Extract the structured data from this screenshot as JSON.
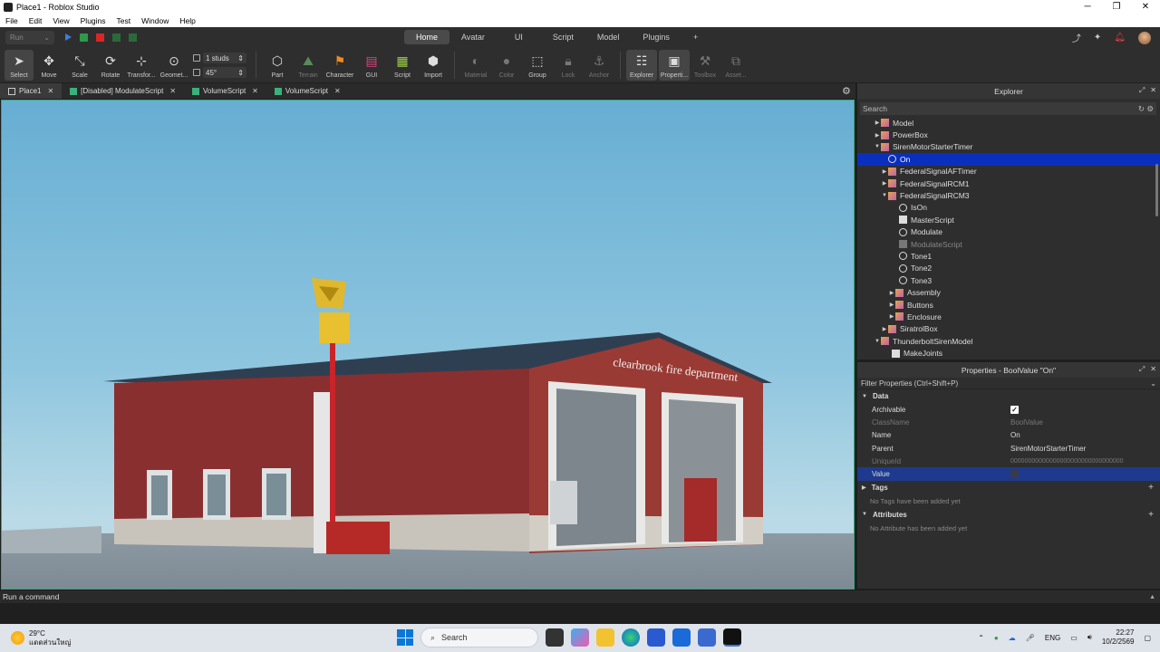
{
  "window": {
    "title": "Place1 - Roblox Studio"
  },
  "menu": [
    "File",
    "Edit",
    "View",
    "Plugins",
    "Test",
    "Window",
    "Help"
  ],
  "run": {
    "label": "Run"
  },
  "ribbon_tabs": [
    {
      "label": "Home",
      "active": true
    },
    {
      "label": "Avatar"
    },
    {
      "label": "UI"
    },
    {
      "label": "Script"
    },
    {
      "label": "Model"
    },
    {
      "label": "Plugins"
    },
    {
      "label": "+"
    }
  ],
  "tools": {
    "select": "Select",
    "move": "Move",
    "scale": "Scale",
    "rotate": "Rotate",
    "transform": "Transfor...",
    "geometry": "Geomet...",
    "part": "Part",
    "terrain": "Terrain",
    "character": "Character",
    "gui": "GUI",
    "script": "Script",
    "import": "Import",
    "material": "Material",
    "color": "Color",
    "group": "Group",
    "lock": "Lock",
    "anchor": "Anchor",
    "explorer": "Explorer",
    "properties": "Properti...",
    "toolbox": "Toolbox",
    "assets": "Asset..."
  },
  "snap": {
    "move_value": "1 studs",
    "rotate_value": "45°"
  },
  "doc_tabs": [
    "Place1",
    "[Disabled] ModulateScript",
    "VolumeScript",
    "VolumeScript"
  ],
  "scene": {
    "sign": "clearbrook fire department"
  },
  "explorer": {
    "title": "Explorer",
    "search_placeholder": "Search",
    "items": [
      {
        "label": "Model"
      },
      {
        "label": "PowerBox"
      },
      {
        "label": "SirenMotorStarterTimer"
      },
      {
        "label": "On"
      },
      {
        "label": "FederalSignalAFTimer"
      },
      {
        "label": "FederalSignalRCM1"
      },
      {
        "label": "FederalSignalRCM3"
      },
      {
        "label": "IsOn"
      },
      {
        "label": "MasterScript"
      },
      {
        "label": "Modulate"
      },
      {
        "label": "ModulateScript"
      },
      {
        "label": "Tone1"
      },
      {
        "label": "Tone2"
      },
      {
        "label": "Tone3"
      },
      {
        "label": "Assembly"
      },
      {
        "label": "Buttons"
      },
      {
        "label": "Enclosure"
      },
      {
        "label": "SiratrolBox"
      },
      {
        "label": "ThunderboltSirenModel"
      },
      {
        "label": "MakeJoints"
      }
    ]
  },
  "properties": {
    "title": "Properties - BoolValue \"On\"",
    "filter": "Filter Properties (Ctrl+Shift+P)",
    "sections": {
      "data": "Data",
      "tags": "Tags",
      "attributes": "Attributes"
    },
    "rows": [
      {
        "name": "Archivable",
        "value": ""
      },
      {
        "name": "ClassName",
        "value": "BoolValue"
      },
      {
        "name": "Name",
        "value": "On"
      },
      {
        "name": "Parent",
        "value": "SirenMotorStarterTimer"
      },
      {
        "name": "UniqueId",
        "value": "00000000000000000000000000000000"
      },
      {
        "name": "Value",
        "value": ""
      }
    ],
    "tags_note": "No Tags have been added yet",
    "attributes_note": "No Attribute has been added yet"
  },
  "command_bar": {
    "placeholder": "Run a command"
  },
  "taskbar": {
    "weather_temp": "29°C",
    "weather_desc": "แดดส่วนใหญ่",
    "search": "Search",
    "lang": "ENG",
    "time": "22:27",
    "date": "10/2/2569"
  },
  "colors": {
    "accent": "#0a2fbf",
    "viewport_border": "#3aa57a",
    "brick": "#8a2f2f",
    "roof": "#2f3f52"
  }
}
